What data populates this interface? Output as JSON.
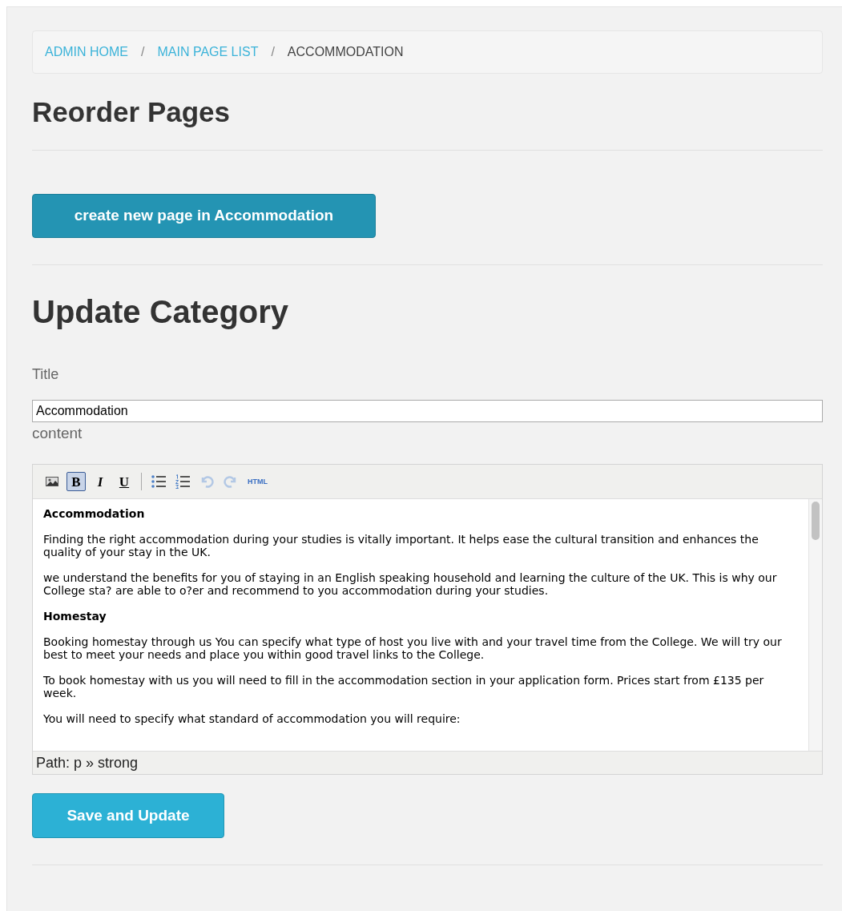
{
  "breadcrumb": [
    {
      "label": "ADMIN HOME",
      "current": false
    },
    {
      "label": "MAIN PAGE LIST",
      "current": false
    },
    {
      "label": "ACCOMMODATION",
      "current": true
    }
  ],
  "breadcrumb_separator": "/",
  "reorder_heading": "Reorder Pages",
  "create_button": "create new page in Accommodation",
  "update_heading": "Update Category",
  "title_field": {
    "label": "Title",
    "value": "Accommodation"
  },
  "content_label": "content",
  "toolbar": [
    {
      "kind": "image",
      "selected": false,
      "disabled": false
    },
    {
      "kind": "bold",
      "label": "B",
      "selected": true,
      "disabled": false
    },
    {
      "kind": "italic",
      "label": "I",
      "selected": false,
      "disabled": false
    },
    {
      "kind": "underline",
      "label": "U",
      "selected": false,
      "disabled": false
    },
    {
      "kind": "separator"
    },
    {
      "kind": "bullets",
      "selected": false,
      "disabled": false
    },
    {
      "kind": "numbers",
      "selected": false,
      "disabled": false
    },
    {
      "kind": "undo",
      "selected": false,
      "disabled": true
    },
    {
      "kind": "redo",
      "selected": false,
      "disabled": true
    },
    {
      "kind": "html",
      "label": "HTML",
      "selected": false,
      "disabled": false
    }
  ],
  "editor_content": [
    {
      "kind": "heading",
      "text": "Accommodation"
    },
    {
      "kind": "paragraph",
      "text": "Finding the right accommodation during your studies is vitally important. It helps ease the cultural transition and enhances the quality of your stay in the UK."
    },
    {
      "kind": "paragraph",
      "text": "we understand the benefits for you of staying in an English speaking household and learning the culture of the UK. This is why our College sta? are able to o?er and recommend to you accommodation during your studies."
    },
    {
      "kind": "heading",
      "text": "Homestay"
    },
    {
      "kind": "paragraph",
      "text": "Booking homestay through us You can specify what type of host you live with and your travel time from the College. We will try our best to meet your needs and place you within good travel links to the College."
    },
    {
      "kind": "paragraph",
      "text": "To book homestay with us you will need to fill in the accommodation section in your application form. Prices start from £135 per week."
    },
    {
      "kind": "paragraph",
      "text": "You will need to specify what standard of accommodation you will require:"
    }
  ],
  "editor_path": "Path: p » strong",
  "save_button": "Save and Update"
}
